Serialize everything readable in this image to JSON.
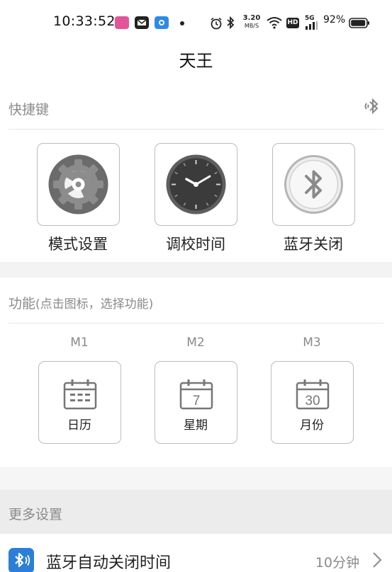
{
  "status_bar": {
    "time": "10:33:52",
    "net_speed_value": "3.20",
    "net_speed_unit": "MB/S",
    "hd_badge": "HD",
    "signal_label": "5G",
    "battery": "92%",
    "icons": [
      "app-pink-icon",
      "message-icon",
      "app-blue-icon",
      "dot-icon",
      "alarm-icon",
      "bluetooth-icon",
      "wifi-icon",
      "battery-icon"
    ]
  },
  "header": {
    "title": "天王"
  },
  "shortcuts": {
    "label": "快捷键",
    "items": [
      {
        "label": "模式设置",
        "icon": "gear-icon"
      },
      {
        "label": "调校时间",
        "icon": "clock-icon"
      },
      {
        "label": "蓝牙关闭",
        "icon": "bluetooth-icon"
      }
    ]
  },
  "functions": {
    "label": "功能",
    "hint": "(点击图标，选择功能)",
    "items": [
      {
        "slot": "M1",
        "label": "日历",
        "icon": "calendar-icon",
        "icon_text": ""
      },
      {
        "slot": "M2",
        "label": "星期",
        "icon": "weekday-calendar-icon",
        "icon_text": "7"
      },
      {
        "slot": "M3",
        "label": "月份",
        "icon": "month-calendar-icon",
        "icon_text": "30"
      }
    ]
  },
  "more_settings": {
    "label": "更多设置",
    "rows": [
      {
        "label": "蓝牙自动关闭时间",
        "value": "10分钟",
        "icon": "bluetooth-icon"
      }
    ]
  },
  "colors": {
    "accent_blue": "#2b7fd9",
    "muted_text": "#8a8a8a",
    "tile_border": "#bcbcbc"
  }
}
